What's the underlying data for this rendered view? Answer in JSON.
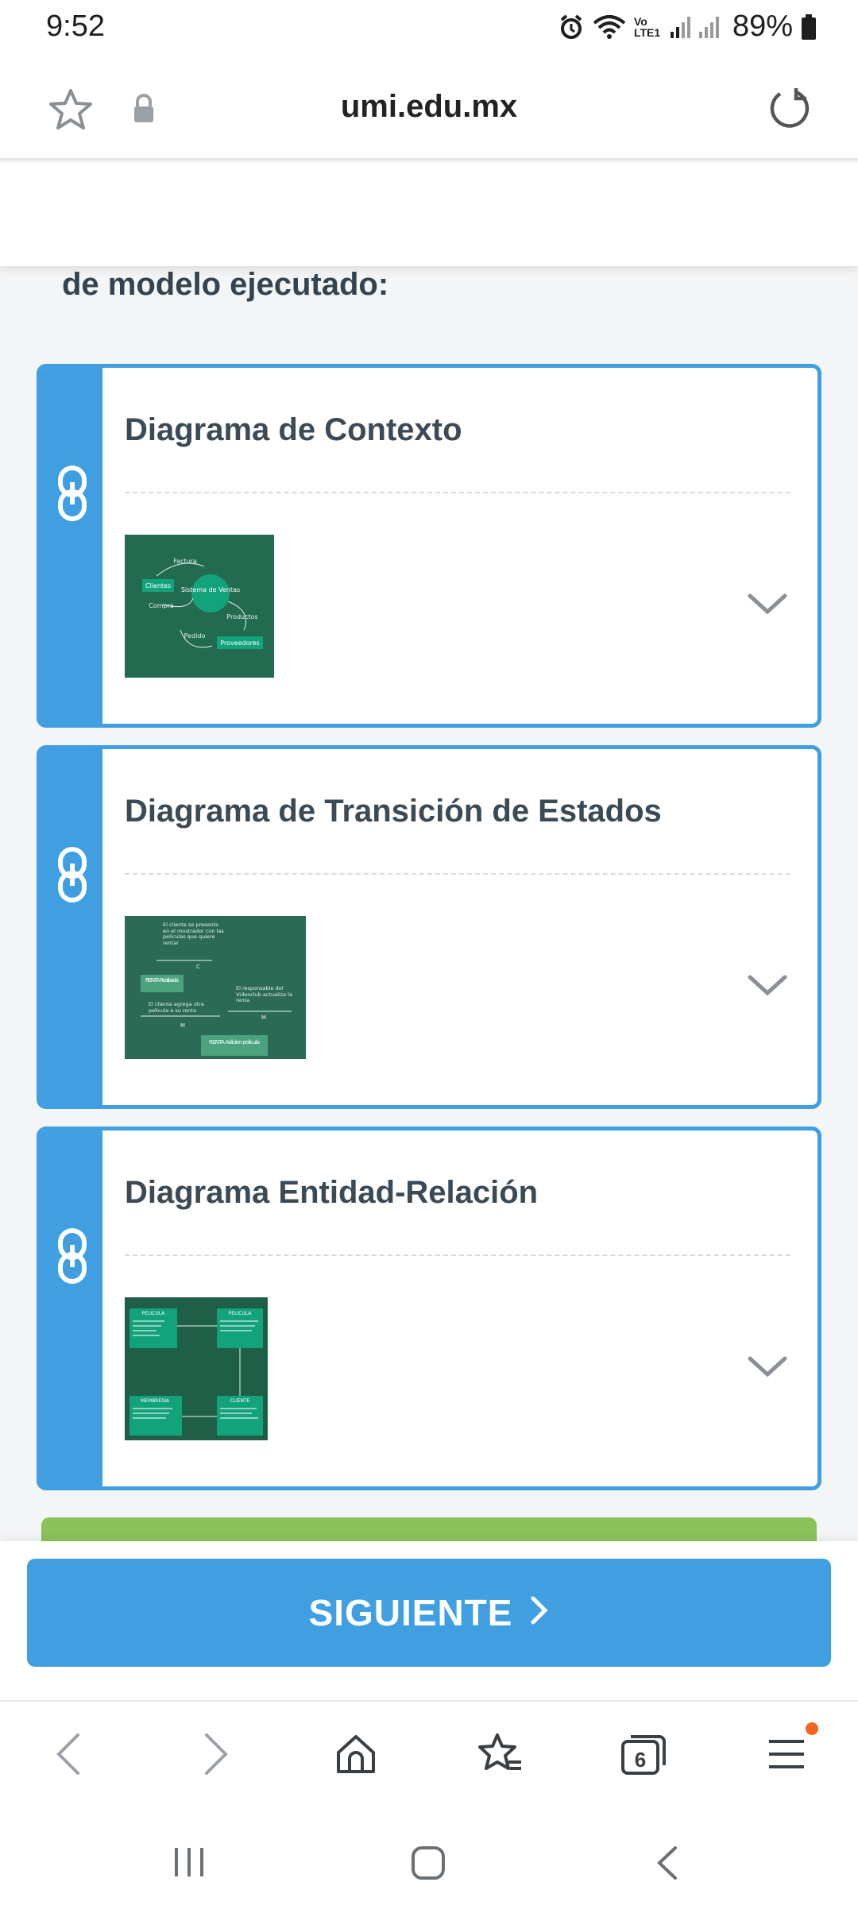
{
  "status_bar": {
    "time": "9:52",
    "network_label": "Vo LTE1",
    "battery_percent": "89%",
    "icons": [
      "alarm-icon",
      "wifi-icon",
      "signal-icon",
      "battery-icon"
    ]
  },
  "browser": {
    "url": "umi.edu.mx"
  },
  "content": {
    "heading": "de modelo ejecutado:",
    "cards": [
      {
        "title": "Diagrama de Contexto",
        "thumbnail": {
          "labels": [
            "Factura",
            "Clientes",
            "Sistema de Ventas",
            "Compra",
            "Productos",
            "Pedido",
            "Proveedores"
          ]
        }
      },
      {
        "title": "Diagrama de Transición de Estados",
        "thumbnail": {
          "labels": [
            "El cliente se presenta en el mostrador con las peliculas que quiere rentar",
            "C",
            "RENTA Realizada",
            "El responsable del Videoclub actualiza la renta",
            "M",
            "El cliente agrega otra pelicula a su renta",
            "M",
            "RENTA Adicion pelicula"
          ]
        }
      },
      {
        "title": "Diagrama Entidad-Relación",
        "thumbnail": {
          "labels": [
            "PELICULA",
            "PELICULA",
            "MEMBRESIA",
            "CLIENTE"
          ]
        }
      }
    ]
  },
  "actions": {
    "next_label": "SIGUIENTE"
  },
  "browser_nav": {
    "tab_count": "6"
  },
  "colors": {
    "accent": "#3f9fe0",
    "green_bar": "#8cc15a",
    "thumbnail_green": "#22684f",
    "notification_dot": "#f26522"
  }
}
